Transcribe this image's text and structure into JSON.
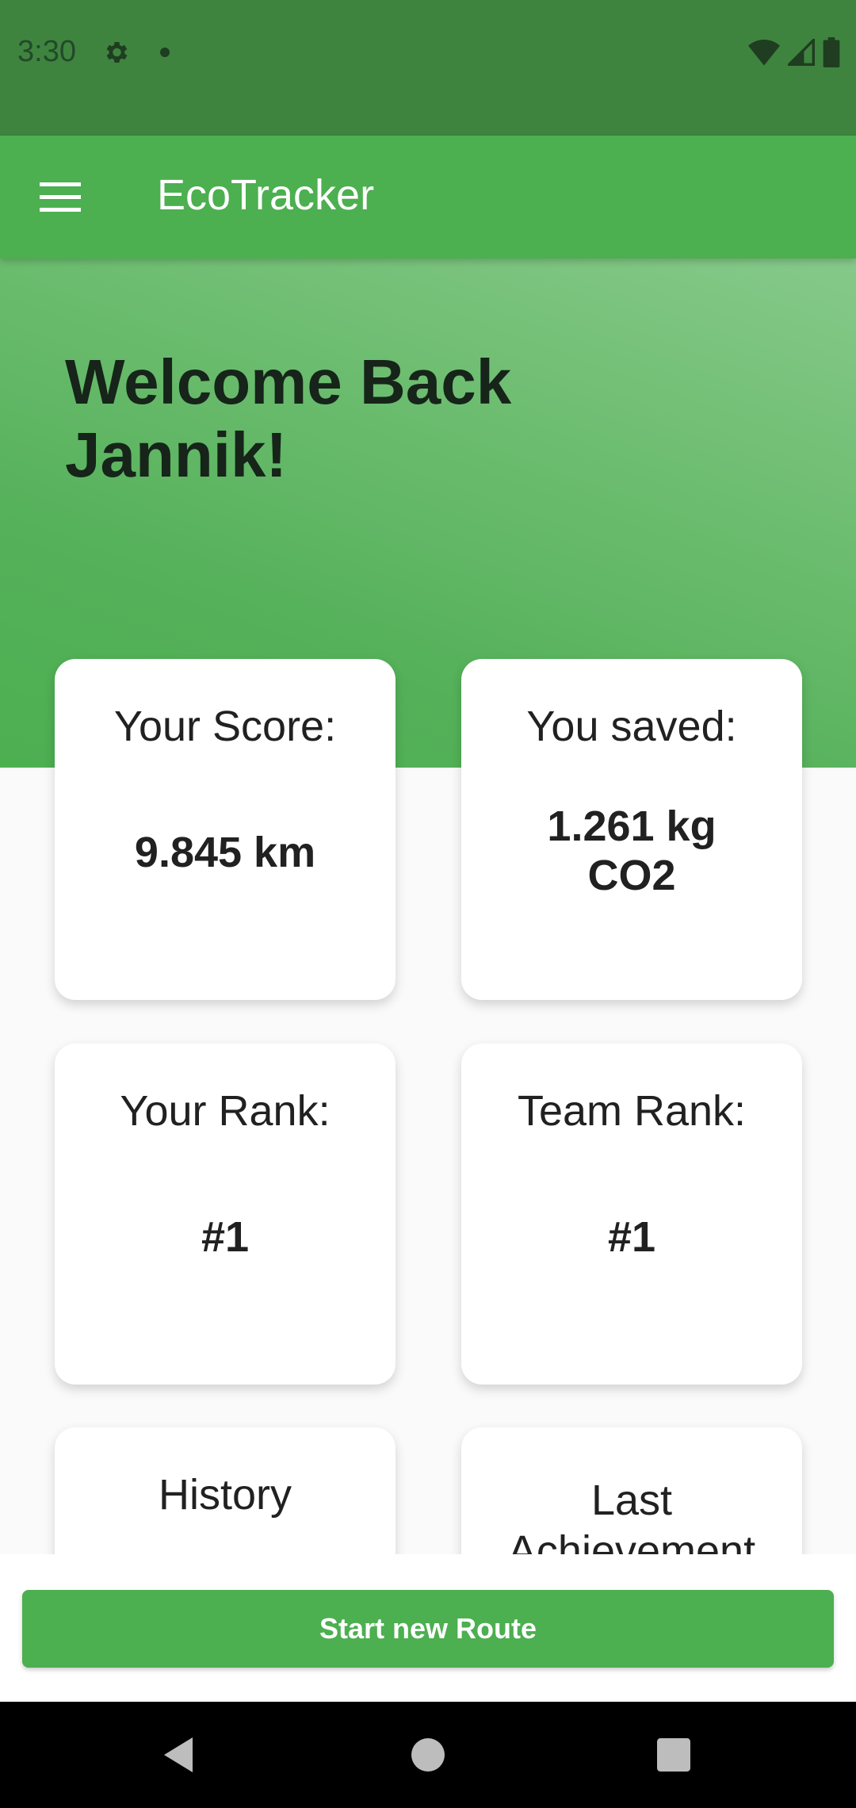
{
  "status_bar": {
    "time": "3:30"
  },
  "app_bar": {
    "title": "EcoTracker"
  },
  "hero": {
    "welcome_line1": "Welcome Back",
    "welcome_line2": "Jannik!"
  },
  "cards": {
    "score": {
      "label": "Your Score:",
      "value": "9.845 km"
    },
    "saved": {
      "label": "You saved:",
      "value_line1": "1.261 kg",
      "value_line2": "CO2"
    },
    "rank": {
      "label": "Your Rank:",
      "value": "#1"
    },
    "team_rank": {
      "label": "Team Rank:",
      "value": "#1"
    },
    "history": {
      "label": "History"
    },
    "last_achievement": {
      "label_line1": "Last",
      "label_line2": "Achievement"
    }
  },
  "actions": {
    "start_route": "Start new Route"
  },
  "colors": {
    "primary": "#4caf50",
    "primary_dark": "#3e843f",
    "hero_light": "#86c98a"
  },
  "icons": [
    "gear-icon",
    "wifi-icon",
    "signal-icon",
    "battery-icon",
    "menu-icon",
    "back-icon",
    "home-icon",
    "recents-icon"
  ]
}
